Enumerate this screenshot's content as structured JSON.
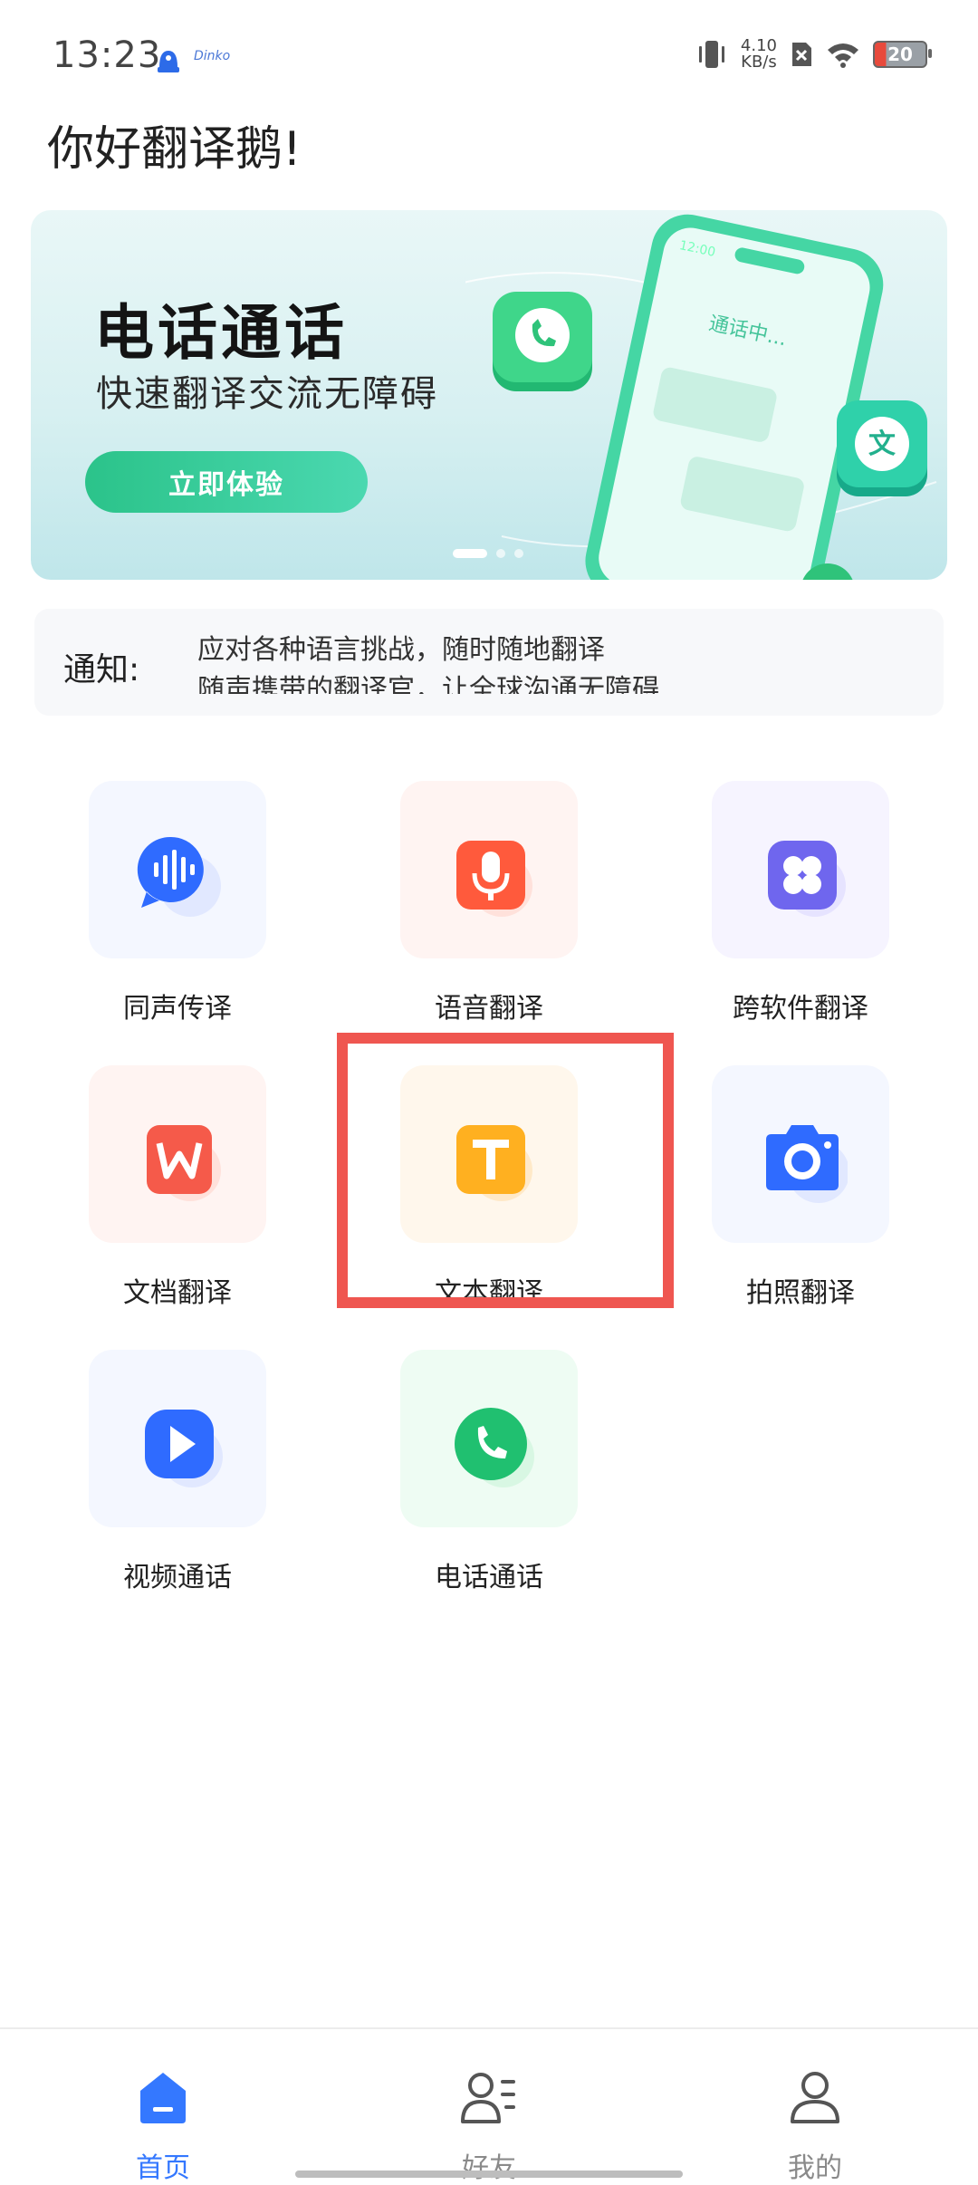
{
  "status_bar": {
    "time": "13:23",
    "network_speed_value": "4.10",
    "network_speed_unit": "KB/s",
    "battery": "20",
    "app_icon_2_label": "Dinko"
  },
  "greeting": "你好翻译鹅!",
  "banner": {
    "title": "电话通话",
    "subtitle": "快速翻译交流无障碍",
    "cta": "立即体验",
    "phone_time": "12:00",
    "phone_status": "通话中...",
    "bubble_char": "文"
  },
  "notice": {
    "label": "通知:",
    "lines": [
      "应对各种语言挑战，随时随地翻译",
      "随声携带的翻译官，让全球沟通无障碍"
    ]
  },
  "features": [
    {
      "label": "同声传译",
      "icon": "sound-wave-icon",
      "color": "#2f6bff"
    },
    {
      "label": "语音翻译",
      "icon": "microphone-icon",
      "color": "#ff5a3c"
    },
    {
      "label": "跨软件翻译",
      "icon": "apps-grid-icon",
      "color": "#6f66ee"
    },
    {
      "label": "文档翻译",
      "icon": "document-w-icon",
      "color": "#f55a4a"
    },
    {
      "label": "文本翻译",
      "icon": "text-t-icon",
      "color": "#ffb020"
    },
    {
      "label": "拍照翻译",
      "icon": "camera-icon",
      "color": "#2f6bff"
    },
    {
      "label": "视频通话",
      "icon": "video-play-icon",
      "color": "#2f6bff"
    },
    {
      "label": "电话通话",
      "icon": "phone-call-icon",
      "color": "#20c070"
    }
  ],
  "bottom_nav": [
    {
      "label": "首页",
      "icon": "home-icon",
      "active": true
    },
    {
      "label": "好友",
      "icon": "friends-icon",
      "active": false
    },
    {
      "label": "我的",
      "icon": "profile-icon",
      "active": false
    }
  ],
  "colors": {
    "accent": "#3478ff",
    "highlight": "#ef5650",
    "cta": "#2bc38a"
  }
}
